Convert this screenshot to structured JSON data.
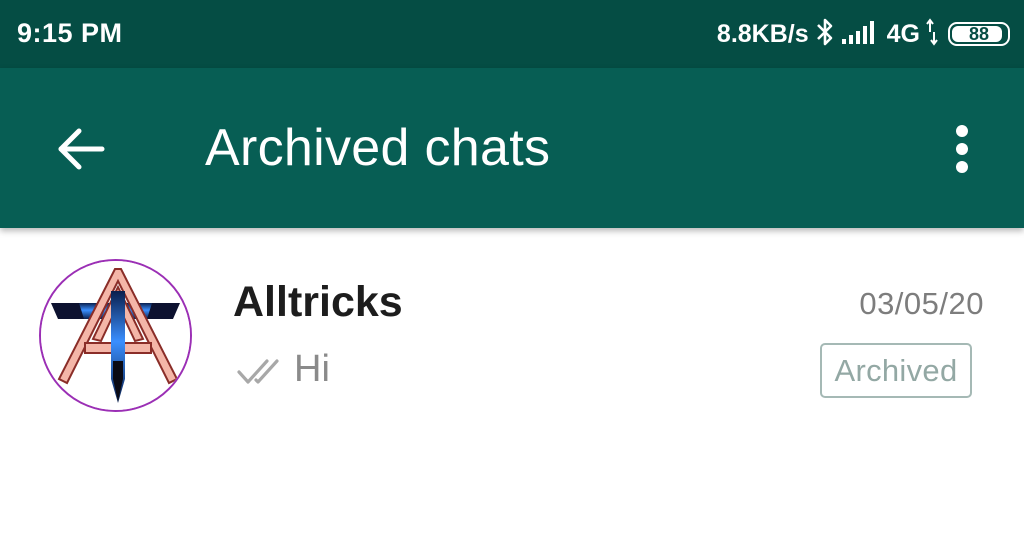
{
  "status_bar": {
    "time": "9:15 PM",
    "net_speed": "8.8KB/s",
    "network_type": "4G",
    "battery_level": "88",
    "icons": [
      "bluetooth-icon",
      "signal-icon",
      "data-arrows-icon",
      "battery-icon"
    ]
  },
  "app_bar": {
    "title": "Archived chats",
    "back_icon": "arrow-left-icon",
    "menu_icon": "more-vertical-icon",
    "color": "#075e54"
  },
  "chats": [
    {
      "name": "Alltricks",
      "date": "03/05/20",
      "last_message": "Hi",
      "status_icon": "double-tick-icon",
      "badge": "Archived"
    }
  ],
  "colors": {
    "status_bar": "#054d44",
    "app_bar": "#075e54",
    "avatar_ring": "#9b2fb5",
    "badge_border": "#a5b9b5"
  }
}
